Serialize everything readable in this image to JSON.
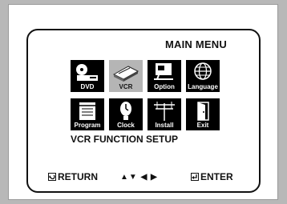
{
  "menu": {
    "title": "MAIN MENU",
    "items": [
      {
        "label": "DVD",
        "icon": "disc-player-icon",
        "selected": false
      },
      {
        "label": "VCR",
        "icon": "vcr-icon",
        "selected": true
      },
      {
        "label": "Option",
        "icon": "monitor-options-icon",
        "selected": false
      },
      {
        "label": "Language",
        "icon": "globe-icon",
        "selected": false
      },
      {
        "label": "Program",
        "icon": "calendar-icon",
        "selected": false
      },
      {
        "label": "Clock",
        "icon": "clock-icon",
        "selected": false
      },
      {
        "label": "Install",
        "icon": "antenna-icon",
        "selected": false
      },
      {
        "label": "Exit",
        "icon": "exit-door-icon",
        "selected": false
      }
    ],
    "function_text": "VCR FUNCTION SETUP"
  },
  "footer": {
    "return_label": "RETURN",
    "arrows": "▲▼ ◀ ▶",
    "enter_label": "ENTER"
  },
  "colors": {
    "tile": "#000000",
    "selected_tile": "#b5b5b5",
    "background": "#ffffff",
    "frame": "#b8b8b8"
  }
}
